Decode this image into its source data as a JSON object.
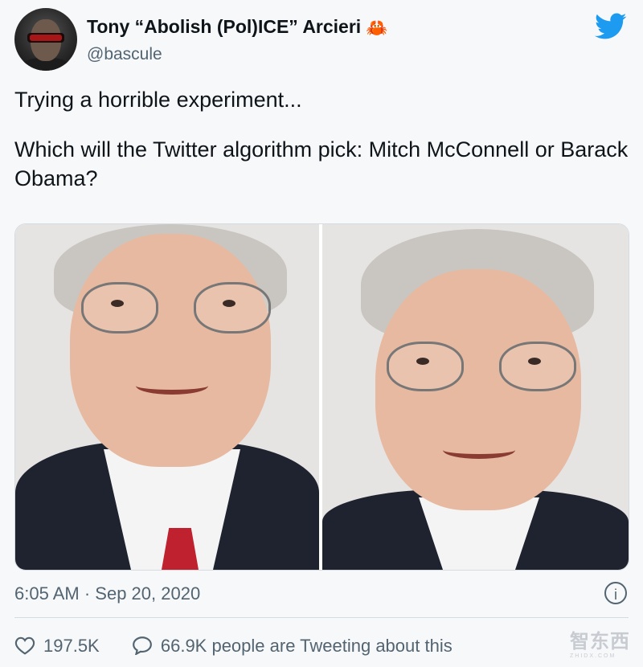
{
  "tweet": {
    "author_name": "Tony “Abolish (Pol)ICE” Arcieri",
    "author_emoji": "🦀",
    "handle": "@bascule",
    "text_line1": "Trying a horrible experiment...",
    "text_line2": "Which will the Twitter algorithm pick: Mitch McConnell or Barack Obama?",
    "time": "6:05 AM",
    "separator": "·",
    "date": "Sep 20, 2020",
    "info_icon": "i",
    "likes": "197.5K",
    "tweeting_count": "66.9K people are Tweeting about this"
  },
  "icons": {
    "twitter": "twitter-bird-icon",
    "like": "heart-icon",
    "reply": "speech-bubble-icon",
    "info": "info-icon"
  },
  "watermark": {
    "text": "智东西",
    "subtext": "ZHIDX.COM"
  },
  "colors": {
    "twitter_blue": "#1d9bf0",
    "text": "#0f1419",
    "secondary": "#536471",
    "background": "#f7f8fa"
  }
}
